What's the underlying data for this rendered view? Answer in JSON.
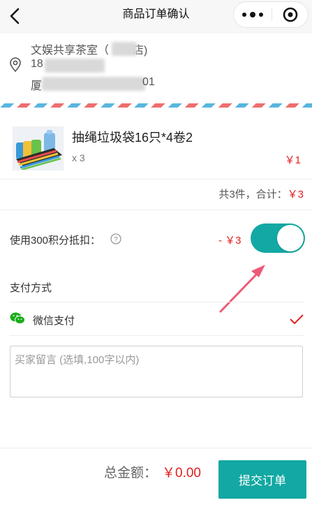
{
  "navbar": {
    "title": "商品订单确认",
    "back_icon": "chevron-left-icon",
    "more_icon": "more-dots-icon",
    "close_icon": "mini-program-close-icon"
  },
  "address": {
    "icon": "location-pin-icon",
    "store_prefix": "文娱共享茶室（",
    "store_suffix": "店)",
    "phone_prefix": "18",
    "addr_prefix": "厦",
    "addr_suffix": "01"
  },
  "product": {
    "name": "抽绳垃圾袋16只*4卷2",
    "quantity": "x 3",
    "price": "￥1"
  },
  "summary": {
    "text": "共3件，合计：",
    "amount": "￥3"
  },
  "points": {
    "label": "使用300积分抵扣：",
    "help_icon": "question-circle-icon",
    "deduction": "- ￥3",
    "enabled": true
  },
  "payment": {
    "title": "支付方式",
    "method_icon": "wechat-pay-icon",
    "method": "微信支付",
    "selected": true,
    "check_icon": "check-icon"
  },
  "remark": {
    "placeholder": "买家留言 (选填,100字以内)",
    "value": ""
  },
  "footer": {
    "total_label": "总金额：",
    "total_value": "￥0.00",
    "submit_label": "提交订单"
  },
  "colors": {
    "accent": "#13a8a3",
    "price_red": "#e02020",
    "airmail_blue": "#58b6e0",
    "airmail_red": "#ee6e6e",
    "wechat_green": "#1aad19"
  }
}
